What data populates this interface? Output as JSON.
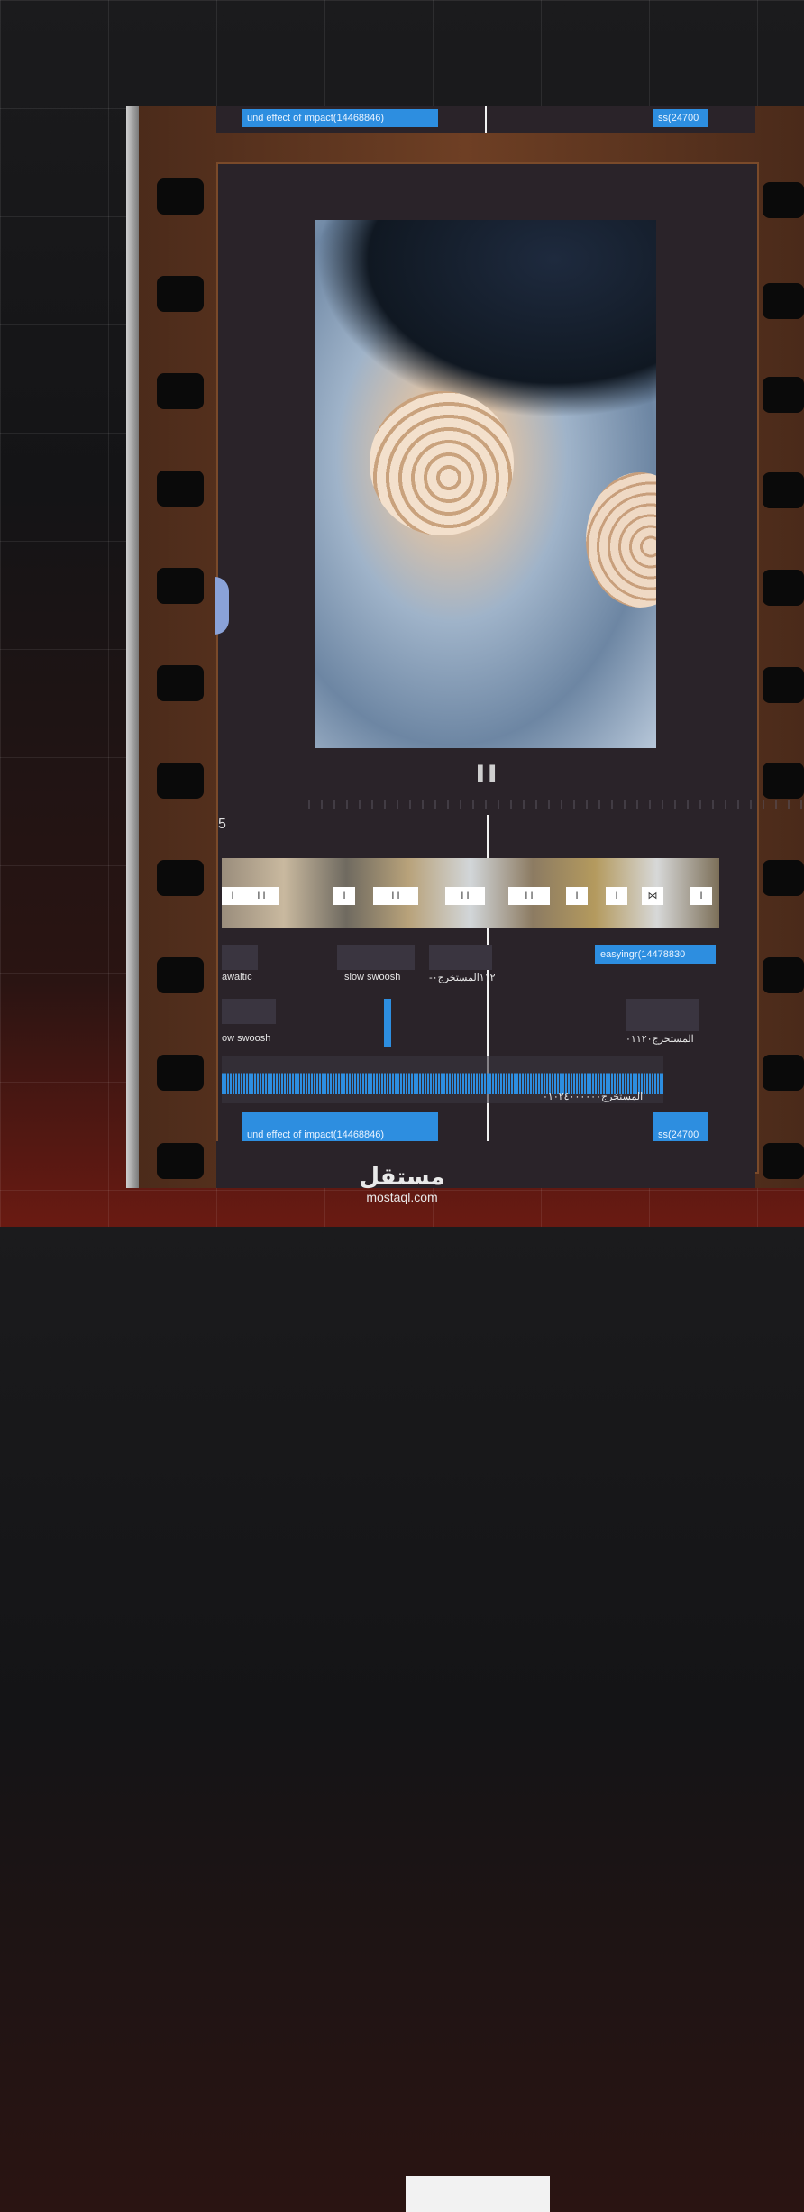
{
  "top_strip": {
    "left_tag": "und effect of impact(14468846)",
    "right_tag": "ss(24700"
  },
  "preview": {
    "pause_icon": "pause-icon"
  },
  "timeline": {
    "track_number": "5",
    "thumb_controls": [
      "I",
      "I I",
      "I I",
      "I",
      "I I",
      "I I",
      "I I",
      "I",
      "I",
      "⋈",
      "I"
    ],
    "audio_row1": {
      "clip1_label": "awaltic",
      "clip2_label": "slow swoosh",
      "clip3_label": "-١١٢المستخرج٠",
      "clip4_label": "easyingr(14478830"
    },
    "audio_row2": {
      "clip1_label": "ow swoosh",
      "clip2_label": "المستخرج٠١١٢٠"
    },
    "wave_label": "المستخرج٠١٠٢٤٠٠٠٠٠٠",
    "bottom_left_tag": "und effect of impact(14468846)",
    "bottom_right_tag": "ss(24700"
  },
  "watermark": {
    "logo_text": "مستقل",
    "url": "mostaql.com"
  },
  "colors": {
    "accent": "#2d8ee0",
    "film": "#6e3f24",
    "panel": "#2a2329"
  }
}
